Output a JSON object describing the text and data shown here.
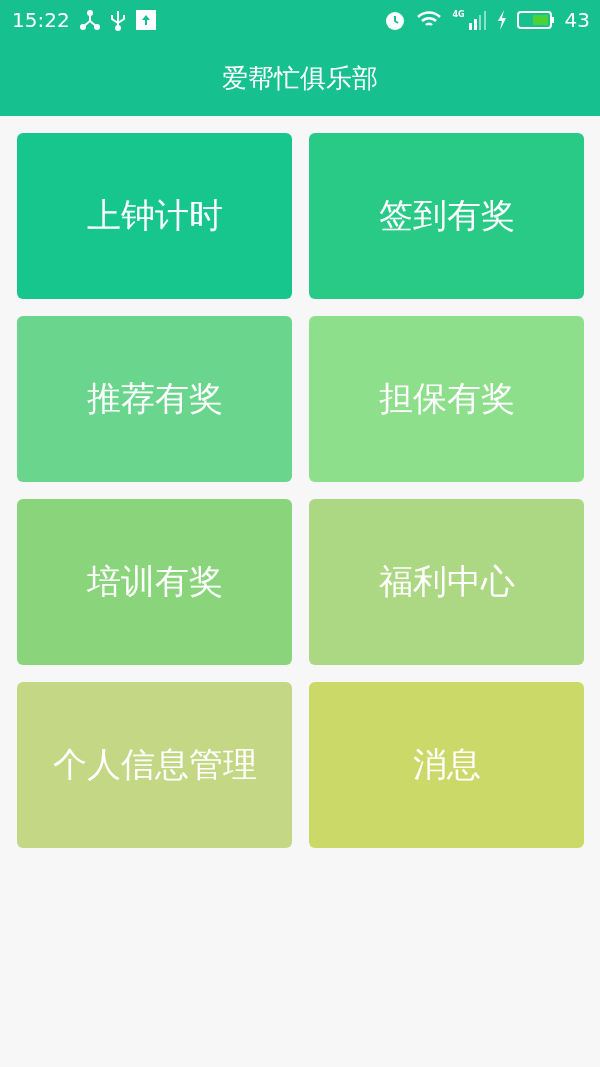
{
  "status_bar": {
    "time": "15:22",
    "network": "4G",
    "battery": "43"
  },
  "title_bar": {
    "title": "爱帮忙俱乐部"
  },
  "tiles": [
    {
      "label": "上钟计时",
      "color": "#16c68c"
    },
    {
      "label": "签到有奖",
      "color": "#28ca85"
    },
    {
      "label": "推荐有奖",
      "color": "#6ad58c"
    },
    {
      "label": "担保有奖",
      "color": "#8edf8c"
    },
    {
      "label": "培训有奖",
      "color": "#8ad47c"
    },
    {
      "label": "福利中心",
      "color": "#acd883"
    },
    {
      "label": "个人信息管理",
      "color": "#c4d784"
    },
    {
      "label": "消息",
      "color": "#cad967"
    }
  ]
}
